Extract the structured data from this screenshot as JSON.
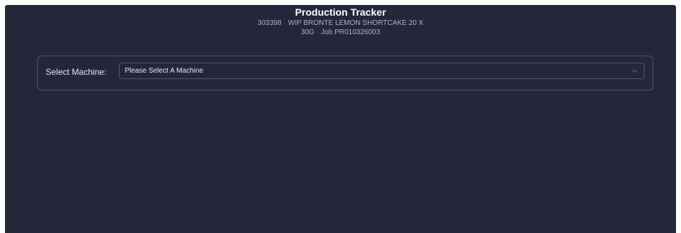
{
  "header": {
    "title": "Production Tracker",
    "product_code": "303398",
    "product_name": "WIP BRONTE LEMON SHORTCAKE 20 X",
    "product_size": "30G",
    "job": "Job PR010326003",
    "separator": "·"
  },
  "machine": {
    "label": "Select Machine:",
    "selected": "Please Select A Machine",
    "chevron_icon": "chevron-down-icon"
  },
  "colors": {
    "background": "#24273a",
    "text": "#e6e8ef",
    "muted": "#aeb2c1",
    "border": "#4f5468"
  }
}
